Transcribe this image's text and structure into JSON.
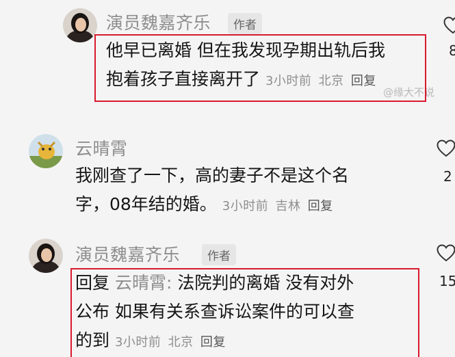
{
  "comments": [
    {
      "username": "演员魏嘉齐乐",
      "author_tag": "作者",
      "lines": [
        "他早已离婚 但在我发现孕期出轨后我",
        "抱着孩子直接离开了"
      ],
      "time": "3小时前",
      "location": "北京",
      "reply_label": "回复",
      "likes": "8"
    },
    {
      "username": "云晴霄",
      "lines": [
        "我刚查了一下，高的妻子不是这个名",
        "字，08年结的婚。"
      ],
      "time": "3小时前",
      "location": "吉林",
      "reply_label": "回复",
      "likes": "2"
    },
    {
      "username": "演员魏嘉齐乐",
      "author_tag": "作者",
      "reply_prefix": "回复",
      "reply_to": "云晴霄:",
      "lines": [
        "法院判的离婚 没有对外",
        "公布 如果有关系查诉讼案件的可以查",
        "的到"
      ],
      "time": "3小时前",
      "location": "北京",
      "reply_label": "回复",
      "likes": "15"
    }
  ],
  "watermark": "@缘大不说",
  "colors": {
    "highlight": "#d8192c",
    "muted": "#8d8d8d",
    "text": "#151515"
  },
  "icons": {
    "like": "heart-outline-icon"
  }
}
